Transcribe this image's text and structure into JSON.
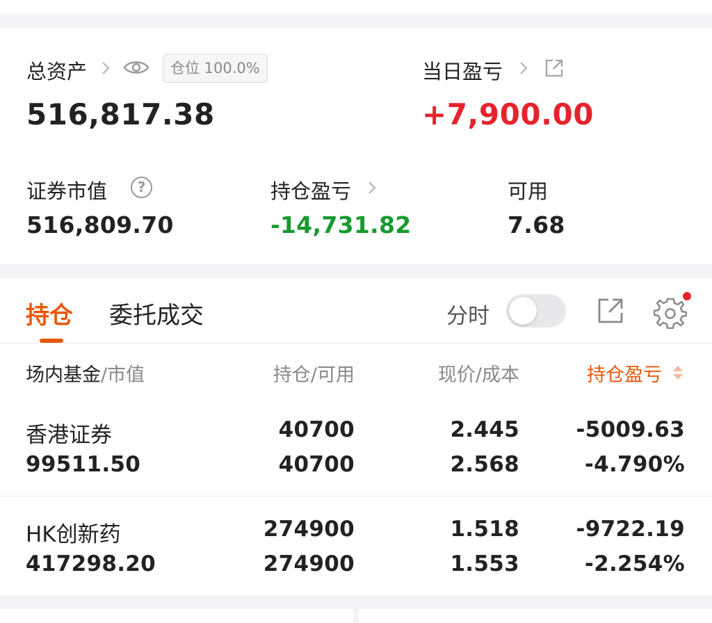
{
  "summary": {
    "total_assets_label": "总资产",
    "position_badge": "仓位 100.0%",
    "total_assets_value": "516,817.38",
    "daily_pnl_label": "当日盈亏",
    "daily_pnl_value": "+7,900.00",
    "market_value_label": "证券市值",
    "market_value_value": "516,809.70",
    "holding_pnl_label": "持仓盈亏",
    "holding_pnl_value": "-14,731.82",
    "available_label": "可用",
    "available_value": "7.68",
    "help_glyph": "?"
  },
  "tabs": {
    "holdings_label": "持仓",
    "orders_label": "委托成交",
    "intraday_label": "分时"
  },
  "table": {
    "headers": {
      "name_primary": "场内基金",
      "name_secondary": "/市值",
      "qty": "持仓/可用",
      "price": "现价/成本",
      "pnl": "持仓盈亏"
    },
    "rows": [
      {
        "name": "香港证券",
        "market_value": "99511.50",
        "position": "40700",
        "available": "40700",
        "price": "2.445",
        "cost": "2.568",
        "pnl": "-5009.63",
        "pnl_pct": "-4.790%"
      },
      {
        "name": "HK创新药",
        "market_value": "417298.20",
        "position": "274900",
        "available": "274900",
        "price": "1.518",
        "cost": "1.553",
        "pnl": "-9722.19",
        "pnl_pct": "-2.254%"
      }
    ]
  },
  "icons": {
    "eye": "eye-icon",
    "external": "external-link-icon",
    "help": "help-circle-icon",
    "gear": "gear-icon",
    "sort": "sort-icon"
  },
  "colors": {
    "accent": "#e8580c",
    "gain": "#e6232c",
    "loss": "#179a2f"
  }
}
